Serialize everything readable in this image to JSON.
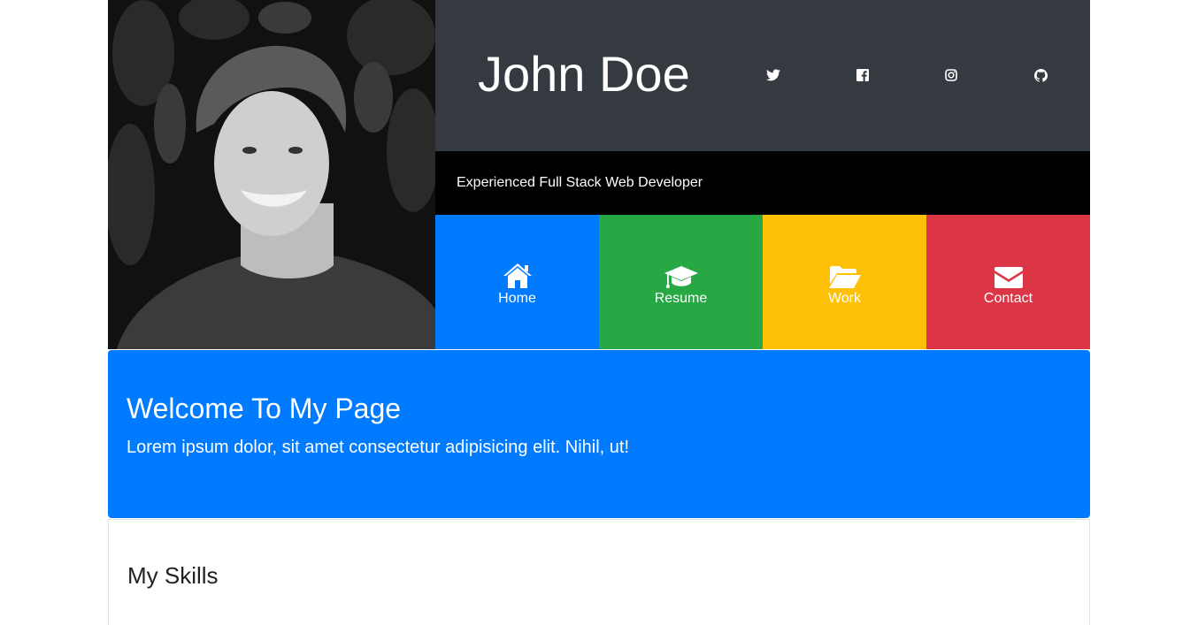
{
  "profile": {
    "name": "John Doe",
    "tagline": "Experienced Full Stack Web Developer",
    "photo_alt": "portrait-photo"
  },
  "social": [
    {
      "icon": "twitter-icon"
    },
    {
      "icon": "facebook-icon"
    },
    {
      "icon": "instagram-icon"
    },
    {
      "icon": "github-icon"
    }
  ],
  "nav": {
    "items": [
      {
        "label": "Home",
        "icon": "home-icon",
        "color": "#007bff"
      },
      {
        "label": "Resume",
        "icon": "graduation-cap-icon",
        "color": "#28a745"
      },
      {
        "label": "Work",
        "icon": "folder-open-icon",
        "color": "#ffc107"
      },
      {
        "label": "Contact",
        "icon": "envelope-icon",
        "color": "#dc3545"
      }
    ]
  },
  "welcome": {
    "heading": "Welcome To My Page",
    "lead": "Lorem ipsum dolor, sit amet consectetur adipisicing elit. Nihil, ut!"
  },
  "skills": {
    "heading": "My Skills"
  },
  "colors": {
    "topbar": "#343a40",
    "tagline_bar": "#000000",
    "welcome_bg": "#007bff"
  }
}
